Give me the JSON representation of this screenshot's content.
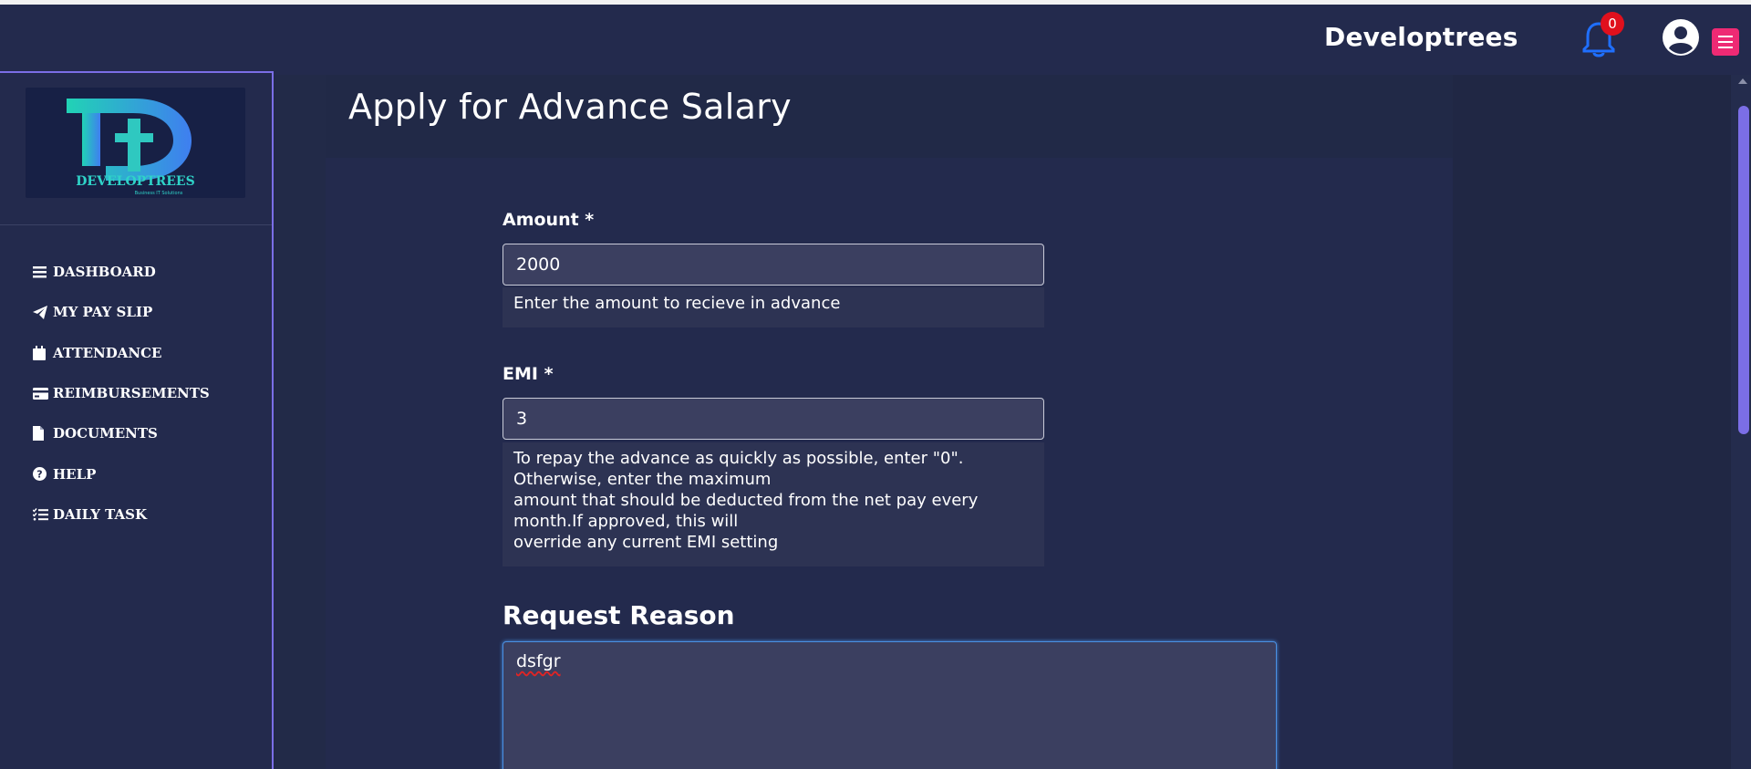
{
  "header": {
    "brand": "Developtrees",
    "notification_count": "0"
  },
  "sidebar": {
    "logo": {
      "letters": "Dt",
      "wordmark": "DEVELOPTREES",
      "tagline": "Business IT Solutions"
    },
    "items": [
      {
        "label": "DASHBOARD",
        "icon": "bars-icon"
      },
      {
        "label": "MY PAY SLIP",
        "icon": "paper-plane-icon"
      },
      {
        "label": "ATTENDANCE",
        "icon": "calendar-icon"
      },
      {
        "label": "REIMBURSEMENTS",
        "icon": "credit-card-icon"
      },
      {
        "label": "DOCUMENTS",
        "icon": "file-icon"
      },
      {
        "label": "HELP",
        "icon": "question-circle-icon"
      },
      {
        "label": "DAILY TASK",
        "icon": "task-list-icon"
      }
    ]
  },
  "form": {
    "title": "Apply for Advance Salary",
    "amount": {
      "label": "Amount *",
      "value": "2000",
      "help": "Enter the amount to recieve in advance"
    },
    "emi": {
      "label": "EMI *",
      "value": "3",
      "help_lines": [
        "To repay the advance as quickly as possible, enter \"0\".",
        "Otherwise, enter the maximum",
        "amount that should be deducted from the net pay every",
        "month.If approved, this will",
        "override any current EMI setting"
      ]
    },
    "reason": {
      "title": "Request Reason",
      "value": "dsfgr"
    }
  },
  "colors": {
    "background": "#232a4d",
    "accent": "#7b6ee6",
    "bell": "#1f6fff",
    "badge": "#e0101d",
    "menu_button": "#ee2a74"
  }
}
